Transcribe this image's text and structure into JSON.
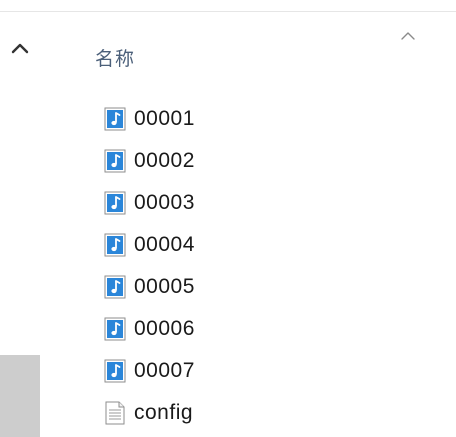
{
  "header": {
    "name_column_label": "名称",
    "sort_icon": "chevron-up-icon"
  },
  "nav_pane": {
    "scroll_up_icon": "chevron-up-icon"
  },
  "files": [
    {
      "name": "00001",
      "icon": "audio-file-icon"
    },
    {
      "name": "00002",
      "icon": "audio-file-icon"
    },
    {
      "name": "00003",
      "icon": "audio-file-icon"
    },
    {
      "name": "00004",
      "icon": "audio-file-icon"
    },
    {
      "name": "00005",
      "icon": "audio-file-icon"
    },
    {
      "name": "00006",
      "icon": "audio-file-icon"
    },
    {
      "name": "00007",
      "icon": "audio-file-icon"
    },
    {
      "name": "config",
      "icon": "text-file-icon"
    }
  ],
  "colors": {
    "audio_icon_blue": "#2b86d9",
    "header_text": "#4c607a",
    "scroll_thumb": "#cdcdcd"
  }
}
